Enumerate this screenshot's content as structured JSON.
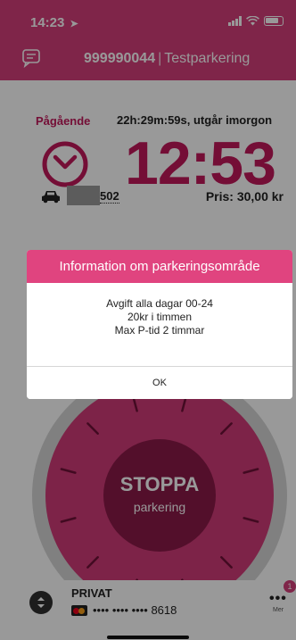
{
  "status_bar": {
    "time": "14:23",
    "location_arrow": "➤"
  },
  "header": {
    "parking_number": "999990044",
    "separator": "|",
    "parking_name": "Testparkering"
  },
  "parking": {
    "status": "Pågående",
    "expiry_text": "22h:29m:59s, utgår imorgon",
    "end_time": "12:53",
    "plate_suffix": "502",
    "price": "Pris: 30,00 kr"
  },
  "dial": {
    "stop_label": "STOPPA",
    "stop_sublabel": "parkering"
  },
  "footer": {
    "account_name": "PRIVAT",
    "card_number": "•••• •••• •••• 8618",
    "more_dots": "•••",
    "more_badge": "1",
    "more_label": "Mer"
  },
  "dialog": {
    "title": "Information om parkeringsområde",
    "lines": [
      "Avgift alla dagar 00-24",
      "20kr i timmen",
      "Max P-tid 2 timmar"
    ],
    "ok_label": "OK"
  },
  "colors": {
    "brand_pink": "#d43f7b",
    "dial_dark": "#8a1a49",
    "text_accent": "#c2185b"
  },
  "icons": [
    "location-arrow-icon",
    "signal-icon",
    "wifi-icon",
    "battery-icon",
    "chat-icon",
    "clock-icon",
    "car-icon",
    "switch-icon",
    "mastercard-icon"
  ]
}
